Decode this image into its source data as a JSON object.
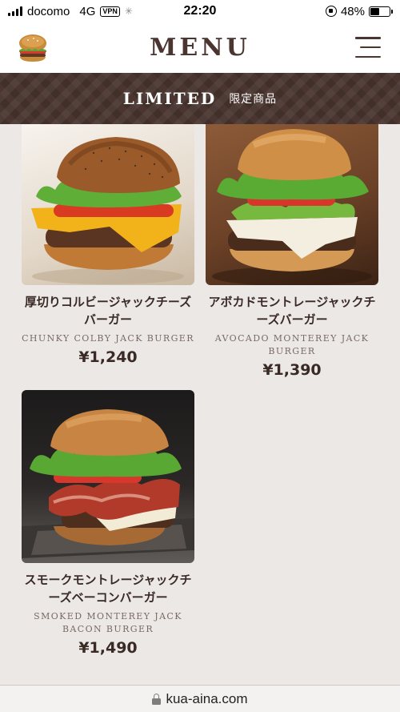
{
  "status_bar": {
    "carrier": "docomo",
    "network": "4G",
    "vpn": "VPN",
    "time": "22:20",
    "battery": "48%",
    "battery_level": 0.48
  },
  "header": {
    "title": "MENU",
    "logo_icon": "burger-logo-icon",
    "menu_icon": "hamburger-menu-icon"
  },
  "banner": {
    "title": "LIMITED",
    "subtitle": "限定商品"
  },
  "products": [
    {
      "name_ja": "厚切りコルビージャックチーズバーガー",
      "name_en": "CHUNKY COLBY JACK BURGER",
      "price": "¥1,240"
    },
    {
      "name_ja": "アボカドモントレージャックチーズバーガー",
      "name_en": "AVOCADO MONTEREY JACK BURGER",
      "price": "¥1,390"
    },
    {
      "name_ja": "スモークモントレージャックチーズベーコンバーガー",
      "name_en": "SMOKED MONTEREY JACK BACON BURGER",
      "price": "¥1,490"
    }
  ],
  "url_bar": {
    "url": "kua-aina.com"
  },
  "colors": {
    "brand_brown": "#4a3530",
    "page_bg": "#ebe8e5"
  }
}
